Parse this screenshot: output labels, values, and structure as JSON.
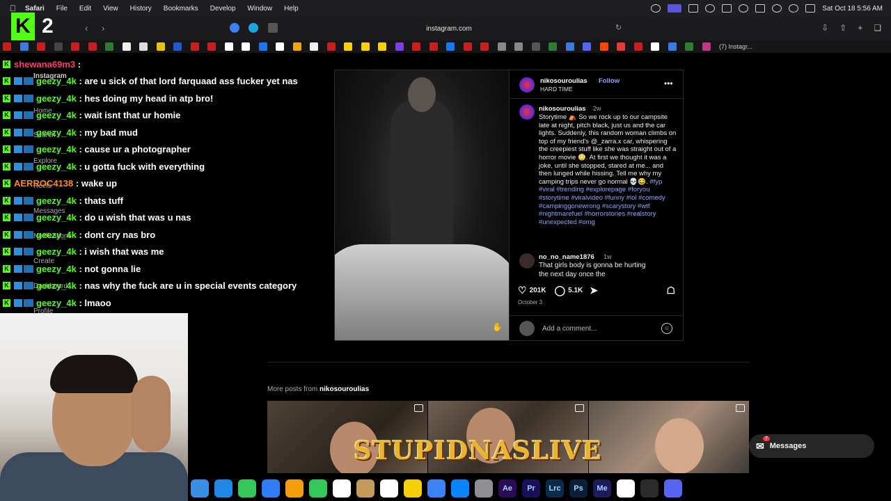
{
  "menubar": {
    "app": "Safari",
    "items": [
      "File",
      "Edit",
      "View",
      "History",
      "Bookmarks",
      "Develop",
      "Window",
      "Help"
    ],
    "clock": "Sat Oct 18  5:56 AM"
  },
  "browser": {
    "url": "instagram.com",
    "favorites_last_label": "(7) Instagr..."
  },
  "overlay": {
    "logo_letter": "K",
    "logo_number": "2",
    "banner_text": "STUPIDNASLIVE"
  },
  "ig_sidebar": [
    "Instagram",
    "Home",
    "Search",
    "Explore",
    "Reels",
    "Messages",
    "Notifications",
    "Create",
    "Dashboard",
    "Profile"
  ],
  "chat": [
    {
      "user": "shewana69m3",
      "text": "",
      "user_color": "#ff3b6b"
    },
    {
      "user": "geezy_4k",
      "text": "are u sick of that lord farquaad ass fucker yet nas"
    },
    {
      "user": "geezy_4k",
      "text": "hes doing my head in atp bro!"
    },
    {
      "user": "geezy_4k",
      "text": "wait isnt that ur homie"
    },
    {
      "user": "geezy_4k",
      "text": "my bad mud"
    },
    {
      "user": "geezy_4k",
      "text": "cause ur a photographer"
    },
    {
      "user": "geezy_4k",
      "text": "u gotta fuck with everything"
    },
    {
      "user": "AERROC4138",
      "text": "wake up",
      "user_color": "#ff8a1f"
    },
    {
      "user": "geezy_4k",
      "text": "thats tuff"
    },
    {
      "user": "geezy_4k",
      "text": "do u wish that was u nas"
    },
    {
      "user": "geezy_4k",
      "text": "dont cry nas bro"
    },
    {
      "user": "geezy_4k",
      "text": "i wish that was me"
    },
    {
      "user": "geezy_4k",
      "text": "not gonna lie"
    },
    {
      "user": "geezy_4k",
      "text": "nas why the fuck are u in special events category"
    },
    {
      "user": "geezy_4k",
      "text": "lmaoo"
    }
  ],
  "post": {
    "username": "nikosouroulias",
    "follow_label": "Follow",
    "audio": "HARD TIME",
    "caption_username": "nikosouroulias",
    "caption_time": "2w",
    "caption": "Storytime ⛺ So we rock up to our campsite late at night, pitch black, just us and the car lights. Suddenly, this random woman climbs on top of my friend's @_zarra.x car, whispering the creepiest stuff like she was straight out of a horror movie 😳. At first we thought it was a joke, until she stopped, stared at me... and then lunged while hissing. Tell me why my camping trips never go normal 💀😂.",
    "hashtags": "#fyp #viral #trending #explorepage #foryou #storytime #viralvideo #funny #lol #comedy #campinggonewrong #scarystory #wtf #nightmarefuel #horrorstories #realstory #unexpected #omg",
    "comment_username": "no_no_name1876",
    "comment_time": "1w",
    "comment_text": "That girls body is gonna be hurting the next day once the",
    "likes": "201K",
    "comments": "5.1K",
    "date": "October 3",
    "comment_placeholder": "Add a comment..."
  },
  "more_posts": {
    "prefix": "More posts from",
    "username": "nikosouroulias"
  },
  "messages_pill": {
    "label": "Messages",
    "badge": "7"
  },
  "dock": [
    "Finder",
    "Safari",
    "Messages",
    "Mail",
    "Photos",
    "FaceTime",
    "Calendar",
    "Notes",
    "Reminders",
    "Notes2",
    "Freeform",
    "App Store",
    "Settings",
    "Ae",
    "Pr",
    "Lrc",
    "Ps",
    "Me",
    "Chrome",
    "OBS",
    "Discord"
  ],
  "colors": {
    "kick_green": "#53fc18",
    "ig_link_blue": "#8aa6ff"
  }
}
